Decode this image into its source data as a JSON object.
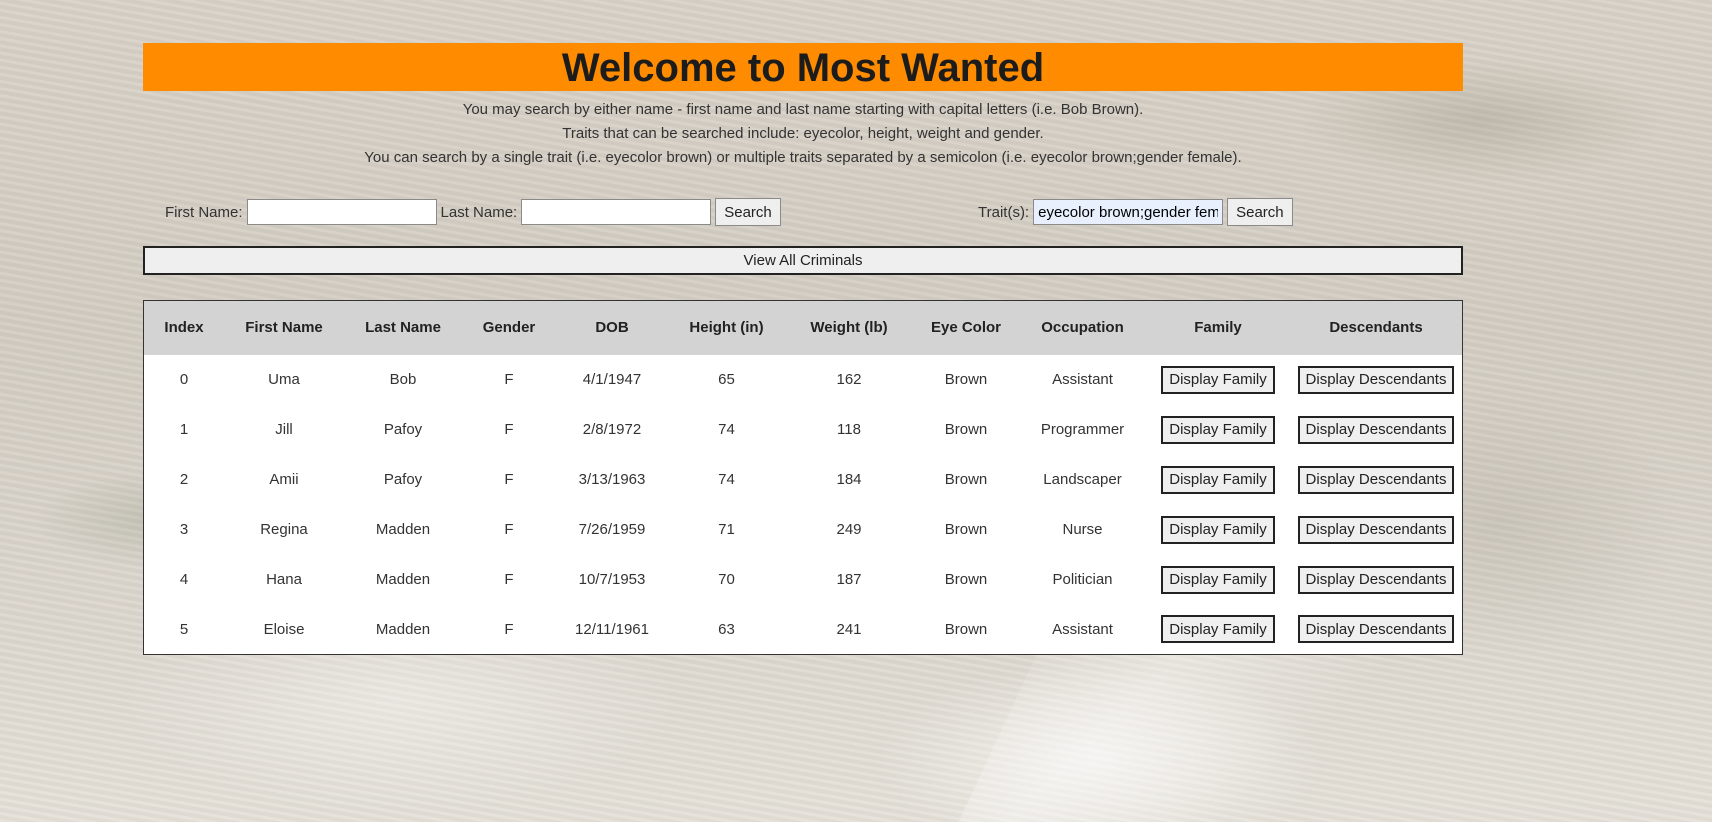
{
  "header": {
    "title": "Welcome to Most Wanted"
  },
  "instructions": [
    "You may search by either name - first name and last name starting with capital letters (i.e. Bob Brown).",
    "Traits that can be searched include: eyecolor, height, weight and gender.",
    "You can search by a single trait (i.e. eyecolor brown) or multiple traits separated by a semicolon (i.e. eyecolor brown;gender female)."
  ],
  "name_search": {
    "first_label": "First Name:",
    "first_value": "",
    "last_label": "Last Name:",
    "last_value": "",
    "button": "Search"
  },
  "trait_search": {
    "label": "Trait(s):",
    "value": "eyecolor brown;gender female",
    "button": "Search"
  },
  "view_all_button": "View All Criminals",
  "table": {
    "headers": [
      "Index",
      "First Name",
      "Last Name",
      "Gender",
      "DOB",
      "Height (in)",
      "Weight (lb)",
      "Eye Color",
      "Occupation",
      "Family",
      "Descendants"
    ],
    "family_button": "Display Family",
    "descendants_button": "Display Descendants",
    "rows": [
      {
        "index": "0",
        "first": "Uma",
        "last": "Bob",
        "gender": "F",
        "dob": "4/1/1947",
        "height": "65",
        "weight": "162",
        "eye": "Brown",
        "occupation": "Assistant"
      },
      {
        "index": "1",
        "first": "Jill",
        "last": "Pafoy",
        "gender": "F",
        "dob": "2/8/1972",
        "height": "74",
        "weight": "118",
        "eye": "Brown",
        "occupation": "Programmer"
      },
      {
        "index": "2",
        "first": "Amii",
        "last": "Pafoy",
        "gender": "F",
        "dob": "3/13/1963",
        "height": "74",
        "weight": "184",
        "eye": "Brown",
        "occupation": "Landscaper"
      },
      {
        "index": "3",
        "first": "Regina",
        "last": "Madden",
        "gender": "F",
        "dob": "7/26/1959",
        "height": "71",
        "weight": "249",
        "eye": "Brown",
        "occupation": "Nurse"
      },
      {
        "index": "4",
        "first": "Hana",
        "last": "Madden",
        "gender": "F",
        "dob": "10/7/1953",
        "height": "70",
        "weight": "187",
        "eye": "Brown",
        "occupation": "Politician"
      },
      {
        "index": "5",
        "first": "Eloise",
        "last": "Madden",
        "gender": "F",
        "dob": "12/11/1961",
        "height": "63",
        "weight": "241",
        "eye": "Brown",
        "occupation": "Assistant"
      }
    ]
  },
  "colors": {
    "header_bg": "#ff8c00",
    "table_header_bg": "#d3d3d3",
    "trait_input_bg": "#e8f0fe"
  }
}
